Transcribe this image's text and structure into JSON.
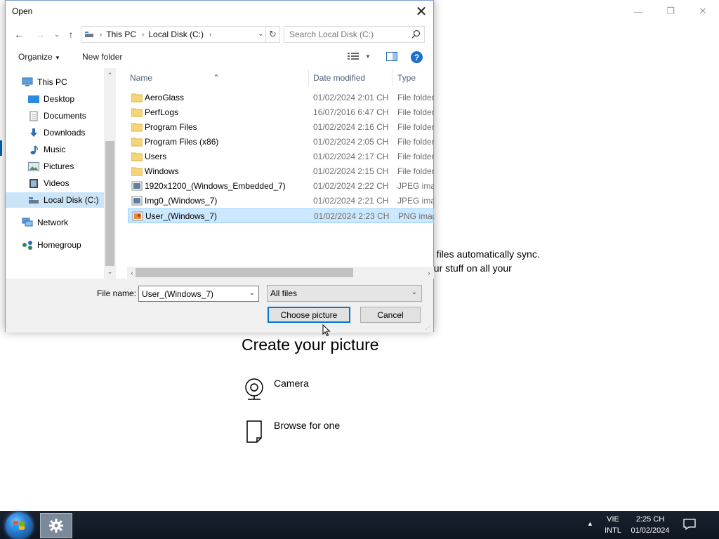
{
  "background_window": {
    "sync_text": "d files automatically sync.\nour stuff on all your",
    "create_title": "Create your picture",
    "options": [
      {
        "label": "Camera",
        "icon": "camera-icon"
      },
      {
        "label": "Browse for one",
        "icon": "document-icon"
      }
    ]
  },
  "dialog": {
    "title": "Open",
    "address": {
      "segments": [
        "This PC",
        "Local Disk (C:)"
      ]
    },
    "search": {
      "placeholder": "Search Local Disk (C:)"
    },
    "toolbar": {
      "organize": "Organize",
      "new_folder": "New folder"
    },
    "nav_items": [
      {
        "label": "This PC",
        "icon": "computer-icon",
        "level": 0
      },
      {
        "label": "Desktop",
        "icon": "desktop-icon",
        "level": 1
      },
      {
        "label": "Documents",
        "icon": "documents-icon",
        "level": 1
      },
      {
        "label": "Downloads",
        "icon": "downloads-icon",
        "level": 1
      },
      {
        "label": "Music",
        "icon": "music-icon",
        "level": 1
      },
      {
        "label": "Pictures",
        "icon": "pictures-icon",
        "level": 1
      },
      {
        "label": "Videos",
        "icon": "videos-icon",
        "level": 1
      },
      {
        "label": "Local Disk (C:)",
        "icon": "drive-icon",
        "level": 1,
        "selected": true
      },
      {
        "label": "Network",
        "icon": "network-icon",
        "level": 0
      },
      {
        "label": "Homegroup",
        "icon": "homegroup-icon",
        "level": 0
      }
    ],
    "columns": {
      "name": "Name",
      "date": "Date modified",
      "type": "Type"
    },
    "files": [
      {
        "name": "AeroGlass",
        "date": "01/02/2024 2:01 CH",
        "type": "File folder",
        "icon": "folder-icon"
      },
      {
        "name": "PerfLogs",
        "date": "16/07/2016 6:47 CH",
        "type": "File folder",
        "icon": "folder-icon"
      },
      {
        "name": "Program Files",
        "date": "01/02/2024 2:16 CH",
        "type": "File folder",
        "icon": "folder-icon"
      },
      {
        "name": "Program Files (x86)",
        "date": "01/02/2024 2:05 CH",
        "type": "File folder",
        "icon": "folder-icon"
      },
      {
        "name": "Users",
        "date": "01/02/2024 2:17 CH",
        "type": "File folder",
        "icon": "folder-icon"
      },
      {
        "name": "Windows",
        "date": "01/02/2024 2:15 CH",
        "type": "File folder",
        "icon": "folder-icon"
      },
      {
        "name": "1920x1200_(Windows_Embedded_7)",
        "date": "01/02/2024 2:22 CH",
        "type": "JPEG image",
        "icon": "jpeg-icon"
      },
      {
        "name": "Img0_(Windows_7)",
        "date": "01/02/2024 2:21 CH",
        "type": "JPEG image",
        "icon": "jpeg-icon"
      },
      {
        "name": "User_(Windows_7)",
        "date": "01/02/2024 2:23 CH",
        "type": "PNG image",
        "icon": "png-icon",
        "selected": true
      }
    ],
    "file_name_label": "File name:",
    "file_name_value": "User_(Windows_7)",
    "file_type": "All files",
    "choose_button": "Choose picture",
    "cancel_button": "Cancel"
  },
  "taskbar": {
    "lang_line1": "VIE",
    "lang_line2": "INTL",
    "time": "2:25 CH",
    "date": "01/02/2024"
  }
}
